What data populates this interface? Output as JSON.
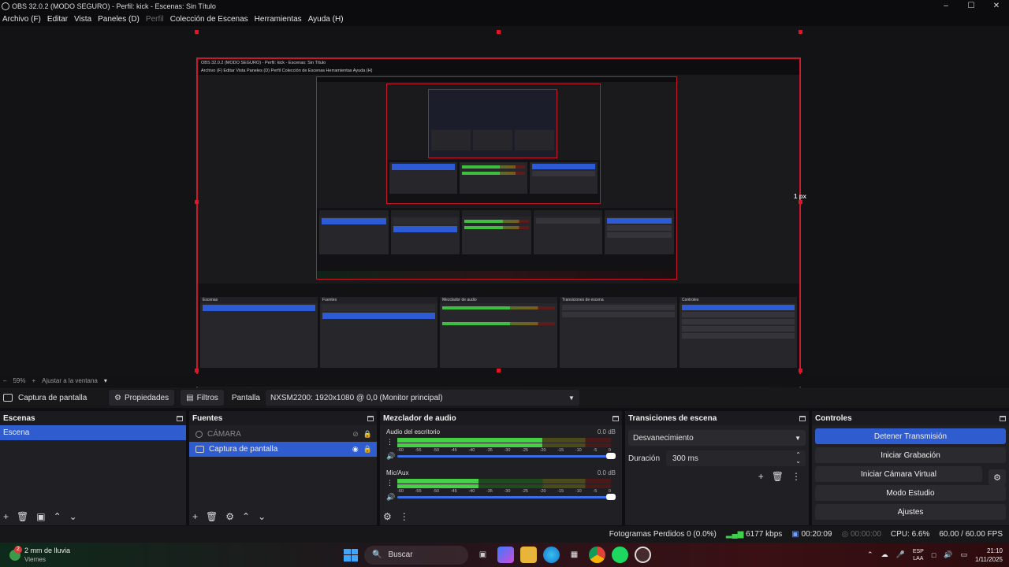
{
  "window": {
    "title": "OBS 32.0.2 (MODO SEGURO) - Perfil: kick - Escenas: Sin Título",
    "controls": [
      "minimize",
      "maximize",
      "close"
    ]
  },
  "menu": {
    "items": [
      {
        "label": "Archivo (F)",
        "enabled": true
      },
      {
        "label": "Editar",
        "enabled": true
      },
      {
        "label": "Vista",
        "enabled": true
      },
      {
        "label": "Paneles (D)",
        "enabled": true
      },
      {
        "label": "Perfil",
        "enabled": false
      },
      {
        "label": "Colección de Escenas",
        "enabled": true
      },
      {
        "label": "Herramientas",
        "enabled": true
      },
      {
        "label": "Ayuda (H)",
        "enabled": true
      }
    ]
  },
  "preview": {
    "px_label": "1 px",
    "nested_title": "OBS 32.0.2 (MODO SEGURO) - Perfil: kick - Escenas: Sin Título",
    "nested_menu": "Archivo (F)   Editar   Vista   Paneles (D)   Perfil   Colección de Escenas   Herramientas   Ayuda (H)",
    "nested_docks": [
      "Escenas",
      "Fuentes",
      "Mezclador de audio",
      "Transiciones de escena",
      "Controles"
    ],
    "accent": "#e0152a"
  },
  "zoom": {
    "minus": "–",
    "value": "59%",
    "plus": "+",
    "fit_label": "Ajustar a la ventana"
  },
  "context": {
    "source_label": "Captura de pantalla",
    "properties": "Propiedades",
    "filters": "Filtros",
    "display_label": "Pantalla",
    "display_value": "NXSM2200: 1920x1080 @ 0,0 (Monitor principal)"
  },
  "scenes": {
    "title": "Escenas",
    "items": [
      {
        "label": "Escena",
        "selected": true
      }
    ]
  },
  "sources": {
    "title": "Fuentes",
    "items": [
      {
        "label": "CÁMARA",
        "visible": false
      },
      {
        "label": "Captura de pantalla",
        "visible": true,
        "selected": true
      }
    ]
  },
  "mixer": {
    "title": "Mezclador de audio",
    "tracks": [
      {
        "name": "Audio del escritorio",
        "db": "0.0 dB",
        "level": 0.68
      },
      {
        "name": "Mic/Aux",
        "db": "0.0 dB",
        "level": 0.38
      }
    ],
    "scale": [
      "-60",
      "-55",
      "-50",
      "-45",
      "-40",
      "-35",
      "-30",
      "-25",
      "-20",
      "-15",
      "-10",
      "-5",
      "0"
    ]
  },
  "transitions": {
    "title": "Transiciones de escena",
    "selected": "Desvanecimiento",
    "duration_label": "Duración",
    "duration_value": "300 ms"
  },
  "controls": {
    "title": "Controles",
    "buttons": [
      "Detener Transmisión",
      "Iniciar Grabación",
      "Iniciar Cámara Virtual",
      "Modo Estudio",
      "Ajustes"
    ],
    "primary_color": "#2f5ccf"
  },
  "status": {
    "dropped": "Fotogramas Perdidos 0 (0.0%)",
    "bitrate": "6177 kbps",
    "stream_time": "00:20:09",
    "rec_time": "00:00:00",
    "cpu": "CPU: 6.6%",
    "fps": "60.00 / 60.00 FPS"
  },
  "taskbar": {
    "weather_badge": "2",
    "weather_line1": "2 mm de lluvia",
    "weather_line2": "Viernes",
    "search_placeholder": "Buscar",
    "lang_line1": "ESP",
    "lang_line2": "LAA",
    "time": "21:10",
    "date": "1/11/2025"
  }
}
